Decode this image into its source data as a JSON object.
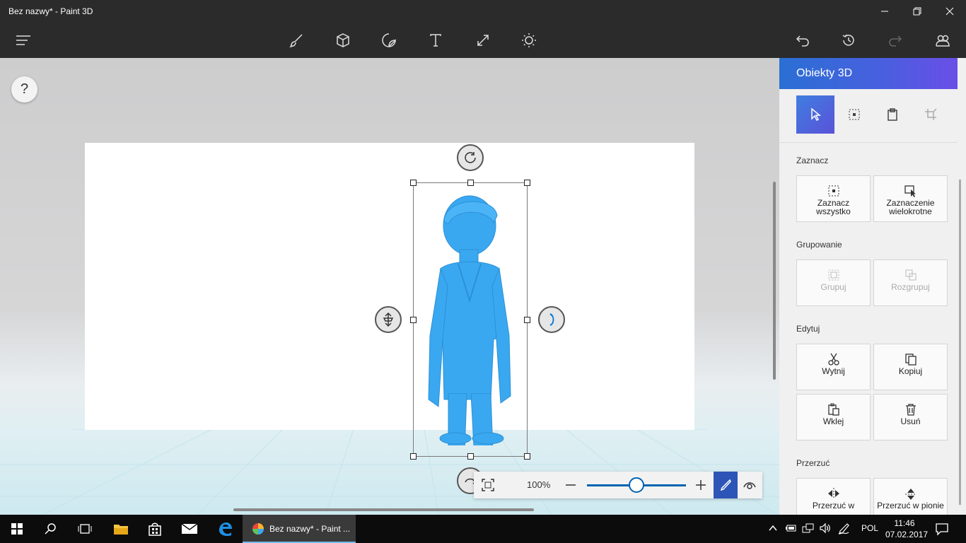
{
  "window": {
    "title": "Bez nazwy* - Paint 3D"
  },
  "toolbar": {
    "left": [
      {
        "icon": "hamburger-menu-icon"
      }
    ],
    "center": [
      {
        "icon": "brush-icon"
      },
      {
        "icon": "3d-cube-icon"
      },
      {
        "icon": "sticker-icon"
      },
      {
        "icon": "text-icon"
      },
      {
        "icon": "canvas-resize-icon"
      },
      {
        "icon": "effects-sun-icon"
      }
    ],
    "right": [
      {
        "icon": "undo-icon"
      },
      {
        "icon": "history-icon"
      },
      {
        "icon": "redo-icon"
      },
      {
        "icon": "community-icon"
      }
    ]
  },
  "canvas": {
    "help_label": "?"
  },
  "zoom": {
    "value_label": "100%",
    "level_percent": 100
  },
  "panel": {
    "title": "Obiekty 3D",
    "sections": {
      "select": {
        "label": "Zaznacz",
        "select_all": "Zaznacz wszystko",
        "multi_select": "Zaznaczenie wielokrotne"
      },
      "grouping": {
        "label": "Grupowanie",
        "group": "Grupuj",
        "ungroup": "Rozgrupuj"
      },
      "edit": {
        "label": "Edytuj",
        "cut": "Wytnij",
        "copy": "Kopiuj",
        "paste": "Wklej",
        "delete": "Usuń"
      },
      "flip": {
        "label": "Przerzuć",
        "flip_h": "Przerzuć w",
        "flip_v": "Przerzuć w pionie"
      }
    }
  },
  "taskbar": {
    "app_label": "Bez nazwy* - Paint ...",
    "language": "POL",
    "time": "11:46",
    "date": "07.02.2017"
  },
  "colors": {
    "accent": "#2d55b7",
    "figure": "#3aa8f0",
    "chrome": "#2b2b2b"
  }
}
